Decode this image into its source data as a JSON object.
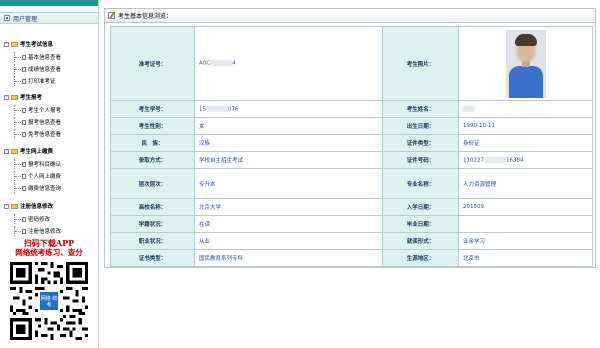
{
  "sidebar": {
    "title": "用户管理",
    "groups": [
      {
        "label": "考生考试信息",
        "items": [
          "基本信息查看",
          "成绩信息查看",
          "打印准考证"
        ]
      },
      {
        "label": "考生报考",
        "items": [
          "考生个人报考",
          "报考信息查看",
          "免考信息查看"
        ]
      },
      {
        "label": "考生网上缴费",
        "items": [
          "报考科目确认",
          "个人网上缴费",
          "缴费信息查询"
        ]
      },
      {
        "label": "注册信息修改",
        "items": [
          "密码修改",
          "注册信息修改"
        ]
      }
    ],
    "promo": {
      "line1": "扫码下载APP",
      "line2": "网络统考练习、查分",
      "qr_logo": "网络 统考"
    }
  },
  "main": {
    "title": "考生基本信息浏览：",
    "fields": {
      "ticket_no_label": "准考证号：",
      "ticket_no_prefix": "A0C",
      "ticket_no_suffix": "4",
      "photo_label": "考生照片：",
      "student_no_label": "考生学号：",
      "student_no_prefix": "15",
      "student_no_suffix": "076",
      "name_label": "考生姓名：",
      "gender_label": "考生性别：",
      "gender_value": "女",
      "birth_label": "出生日期：",
      "birth_value": "1990-10-11",
      "ethnicity_label": "民　族：",
      "ethnicity_value": "汉族",
      "id_type_label": "证件类型：",
      "id_type_value": "身份证",
      "enroll_mode_label": "录取方式：",
      "enroll_mode_value": "学校自主招生考试",
      "id_no_label": "证件号码：",
      "id_no_prefix": "110227",
      "id_no_suffix": "16384",
      "level_label": "层次层次：",
      "level_value": "专升本",
      "major_label": "专业名称：",
      "major_value": "人力资源管理",
      "school_label": "高校名称：",
      "school_value": "北京大学",
      "entry_date_label": "入学日期：",
      "entry_date_value": "201509",
      "status_label": "学籍状况：",
      "status_value": "在读",
      "grad_date_label": "毕业日期：",
      "grad_date_value": "",
      "job_label": "职业状况：",
      "job_value": "从业",
      "study_mode_label": "就读形式：",
      "study_mode_value": "业余学习",
      "cert_type_label": "证书类型：",
      "cert_type_value": "国民教育系列专科",
      "region_label": "生源地区：",
      "region_value": "北京市"
    }
  },
  "colors": {
    "accent": "#1f9a8e",
    "label_bg": "#ddf1f1",
    "value_text": "#1f4fa8",
    "promo_text": "#c00000"
  }
}
